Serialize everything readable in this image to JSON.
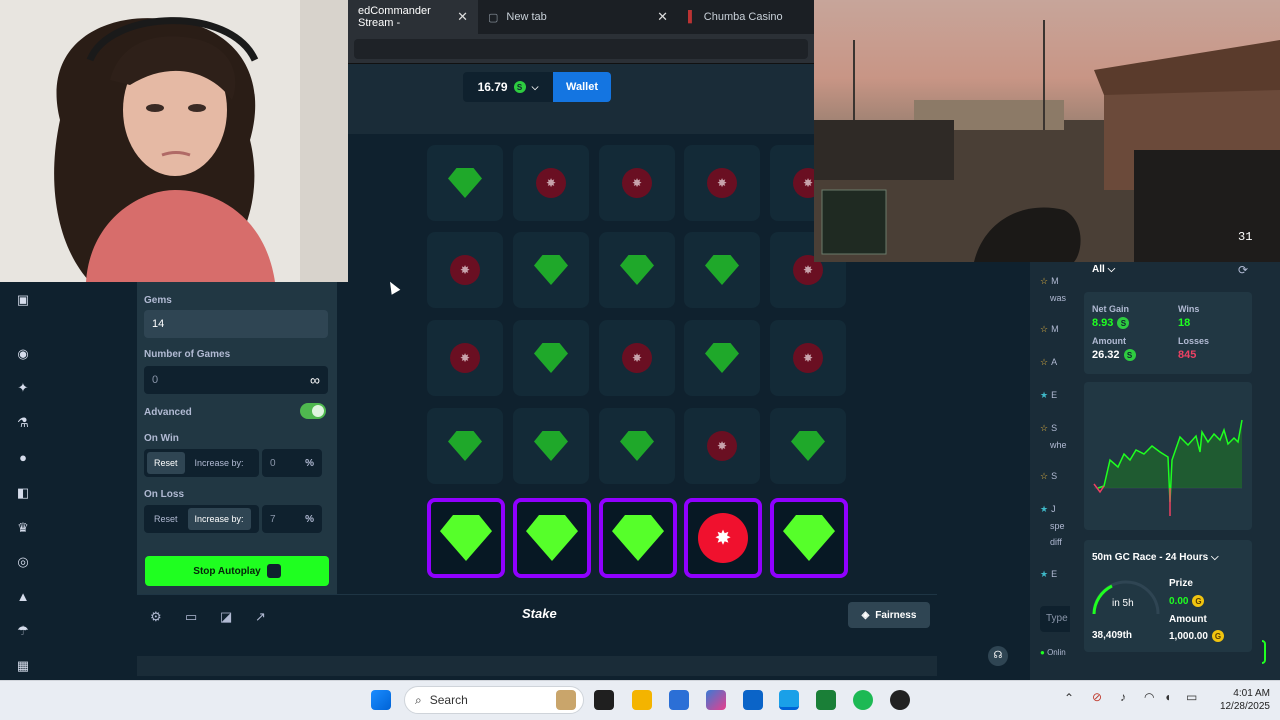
{
  "browser": {
    "tabs": [
      {
        "label": "edCommander Stream -",
        "close": "✕"
      },
      {
        "label": "New tab",
        "close": "✕"
      },
      {
        "label": "Chumba Casino",
        "close": ""
      }
    ]
  },
  "header": {
    "balance": "16.79",
    "currency_icon": "S",
    "wallet_label": "Wallet"
  },
  "control_panel": {
    "gems_label": "Gems",
    "gems_value": "14",
    "games_label": "Number of Games",
    "games_value": "0",
    "infinity": "∞",
    "advanced_label": "Advanced",
    "on_win_label": "On Win",
    "on_win": {
      "reset": "Reset",
      "increase": "Increase by:",
      "value": "0",
      "unit": "%"
    },
    "on_loss_label": "On Loss",
    "on_loss": {
      "reset": "Reset",
      "increase": "Increase by:",
      "value": "7",
      "unit": "%"
    },
    "stop_label": "Stop Autoplay"
  },
  "grid": {
    "rows": [
      [
        "gem",
        "mine",
        "mine",
        "mine",
        "mine"
      ],
      [
        "mine",
        "gem",
        "gem",
        "gem",
        "mine"
      ],
      [
        "mine",
        "gem",
        "mine",
        "gem",
        "mine"
      ],
      [
        "gem",
        "gem",
        "gem",
        "mine",
        "gem"
      ],
      [
        "gem",
        "gem",
        "gem",
        "mine",
        "gem"
      ]
    ],
    "selected_row": 4
  },
  "footer": {
    "logo": "Stake",
    "fairness_label": "Fairness"
  },
  "stats": {
    "filter": "All",
    "net_gain_label": "Net Gain",
    "net_gain": "8.93",
    "wins_label": "Wins",
    "wins": "18",
    "amount_label": "Amount",
    "amount": "26.32",
    "losses_label": "Losses",
    "losses": "845"
  },
  "race": {
    "title": "50m GC Race - 24 Hours",
    "time": "in 5h",
    "rank": "38,409th",
    "prize_label": "Prize",
    "prize": "0.00",
    "amount_label": "Amount",
    "amount": "1,000.00"
  },
  "chat": {
    "rows": [
      "M",
      "was",
      "M",
      "A",
      "E",
      "S",
      "whe",
      "S",
      "J",
      "spe",
      "diff",
      "E"
    ],
    "input_placeholder": "Type",
    "online": "Onlin"
  },
  "taskbar": {
    "search_placeholder": "Search",
    "time": "4:01 AM",
    "date": "12/28/2025"
  },
  "colors": {
    "gem_selected": "#56ff2a",
    "mine_selected": "#f0112e",
    "selection_border": "#9000ff",
    "wallet": "#1475e1",
    "stop_button": "#1fff20"
  }
}
